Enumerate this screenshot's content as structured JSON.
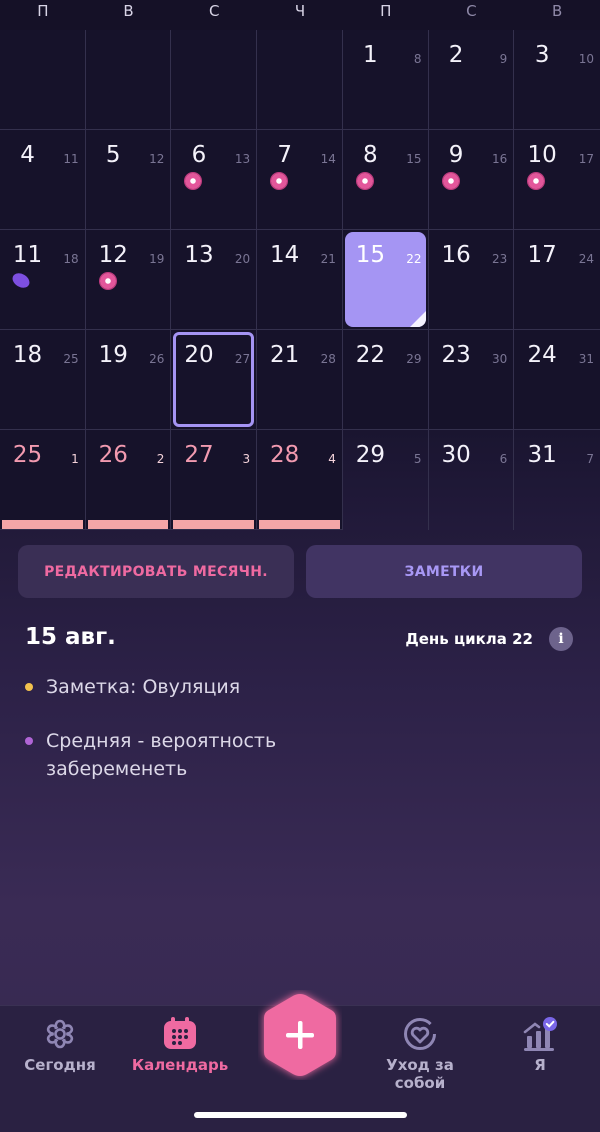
{
  "weekdays": [
    "П",
    "В",
    "С",
    "Ч",
    "П",
    "С",
    "В"
  ],
  "calendar": {
    "rows": [
      [
        {
          "empty": true
        },
        {
          "empty": true
        },
        {
          "empty": true
        },
        {
          "empty": true
        },
        {
          "day": "1",
          "cycle": "8"
        },
        {
          "day": "2",
          "cycle": "9"
        },
        {
          "day": "3",
          "cycle": "10"
        }
      ],
      [
        {
          "day": "4",
          "cycle": "11"
        },
        {
          "day": "5",
          "cycle": "12"
        },
        {
          "day": "6",
          "cycle": "13",
          "marker": "flower"
        },
        {
          "day": "7",
          "cycle": "14",
          "marker": "flower"
        },
        {
          "day": "8",
          "cycle": "15",
          "marker": "flower"
        },
        {
          "day": "9",
          "cycle": "16",
          "marker": "flower"
        },
        {
          "day": "10",
          "cycle": "17",
          "marker": "flower"
        }
      ],
      [
        {
          "day": "11",
          "cycle": "18",
          "marker": "oval"
        },
        {
          "day": "12",
          "cycle": "19",
          "marker": "flower"
        },
        {
          "day": "13",
          "cycle": "20"
        },
        {
          "day": "14",
          "cycle": "21"
        },
        {
          "day": "15",
          "cycle": "22",
          "state": "selected"
        },
        {
          "day": "16",
          "cycle": "23"
        },
        {
          "day": "17",
          "cycle": "24"
        }
      ],
      [
        {
          "day": "18",
          "cycle": "25"
        },
        {
          "day": "19",
          "cycle": "26"
        },
        {
          "day": "20",
          "cycle": "27",
          "state": "today"
        },
        {
          "day": "21",
          "cycle": "28"
        },
        {
          "day": "22",
          "cycle": "29"
        },
        {
          "day": "23",
          "cycle": "30"
        },
        {
          "day": "24",
          "cycle": "31"
        }
      ],
      [
        {
          "day": "25",
          "cycle": "1",
          "state": "period"
        },
        {
          "day": "26",
          "cycle": "2",
          "state": "period"
        },
        {
          "day": "27",
          "cycle": "3",
          "state": "period"
        },
        {
          "day": "28",
          "cycle": "4",
          "state": "period"
        },
        {
          "day": "29",
          "cycle": "5",
          "state": "faded"
        },
        {
          "day": "30",
          "cycle": "6",
          "state": "faded"
        },
        {
          "day": "31",
          "cycle": "7",
          "state": "faded"
        }
      ]
    ]
  },
  "actions": {
    "edit_label": "РЕДАКТИРОВАТЬ МЕСЯЧН.",
    "notes_label": "ЗАМЕТКИ"
  },
  "details": {
    "date": "15 авг.",
    "cycle_day": "День цикла 22",
    "info_icon": "i",
    "notes": [
      {
        "text": "Заметка: Овуляция",
        "dot_color": "#f2c14e"
      },
      {
        "text": "Средняя - вероятность забеременеть",
        "dot_color": "#b065d6"
      }
    ]
  },
  "nav": {
    "items": [
      {
        "label": "Сегодня",
        "icon": "flower-outline-icon"
      },
      {
        "label": "Календарь",
        "icon": "calendar-icon",
        "active": true
      },
      {
        "label": "Уход за собой",
        "icon": "heart-circle-icon"
      },
      {
        "label": "Я",
        "icon": "stats-icon"
      }
    ],
    "fab_icon": "plus-icon"
  },
  "colors": {
    "accent_pink": "#ef6aa1",
    "accent_purple": "#a595f3",
    "period": "#f4a6a7"
  }
}
